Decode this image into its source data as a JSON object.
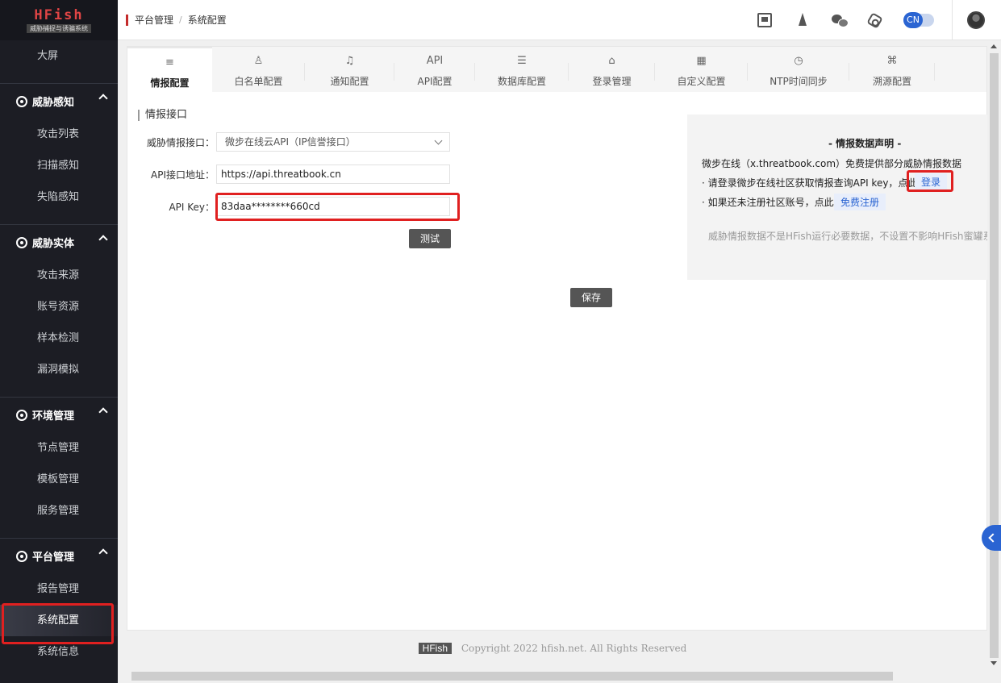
{
  "logo": {
    "title": "HFish",
    "subtitle": "威胁捕捉与诱骗系统"
  },
  "sidebar": {
    "top_item": "大屏",
    "groups": [
      {
        "label": "威胁感知",
        "items": [
          "攻击列表",
          "扫描感知",
          "失陷感知"
        ]
      },
      {
        "label": "威胁实体",
        "items": [
          "攻击来源",
          "账号资源",
          "样本检测",
          "漏洞模拟"
        ]
      },
      {
        "label": "环境管理",
        "items": [
          "节点管理",
          "模板管理",
          "服务管理"
        ]
      },
      {
        "label": "平台管理",
        "items": [
          "报告管理",
          "系统配置",
          "系统信息"
        ]
      }
    ],
    "active_item": "系统配置"
  },
  "breadcrumb": {
    "parent": "平台管理",
    "separator": "/",
    "current": "系统配置"
  },
  "topbar": {
    "lang": "CN"
  },
  "tabs": [
    {
      "icon": "≡",
      "label": "情报配置"
    },
    {
      "icon": "♙",
      "label": "白名单配置"
    },
    {
      "icon": "♫",
      "label": "通知配置"
    },
    {
      "icon": "API",
      "label": "API配置"
    },
    {
      "icon": "☰",
      "label": "数据库配置"
    },
    {
      "icon": "⌂",
      "label": "登录管理"
    },
    {
      "icon": "▦",
      "label": "自定义配置"
    },
    {
      "icon": "◷",
      "label": "NTP时间同步"
    },
    {
      "icon": "⌘",
      "label": "溯源配置"
    }
  ],
  "intel": {
    "section_title": "情报接口",
    "interface_label": "威胁情报接口：",
    "interface_value": "微步在线云API（IP信誉接口）",
    "api_url_label": "API接口地址：",
    "api_url_value": "https://api.threatbook.cn",
    "api_key_label": "API Key：",
    "api_key_value": "83daa********660cd",
    "test_button": "测试",
    "save_button": "保存"
  },
  "notice": {
    "title": "- 情报数据声明 -",
    "line1": "微步在线（x.threatbook.com）免费提供部分威胁情报数据",
    "line2": "· 请登录微步在线社区获取情报查询API key，点此",
    "login_link": "登录",
    "line3": "· 如果还未注册社区账号，点此",
    "register_link": "免费注册",
    "note": "威胁情报数据不是HFish运行必要数据，不设置不影响HFish蜜罐系统"
  },
  "footer": {
    "logo": "HFish",
    "copyright": "Copyright 2022 hfish.net. All Rights Reserved"
  },
  "colors": {
    "sidebar_bg": "#1c1d24",
    "accent_blue": "#2a64d2",
    "highlight_red": "#e02020",
    "brand_red": "#c42b2b"
  }
}
